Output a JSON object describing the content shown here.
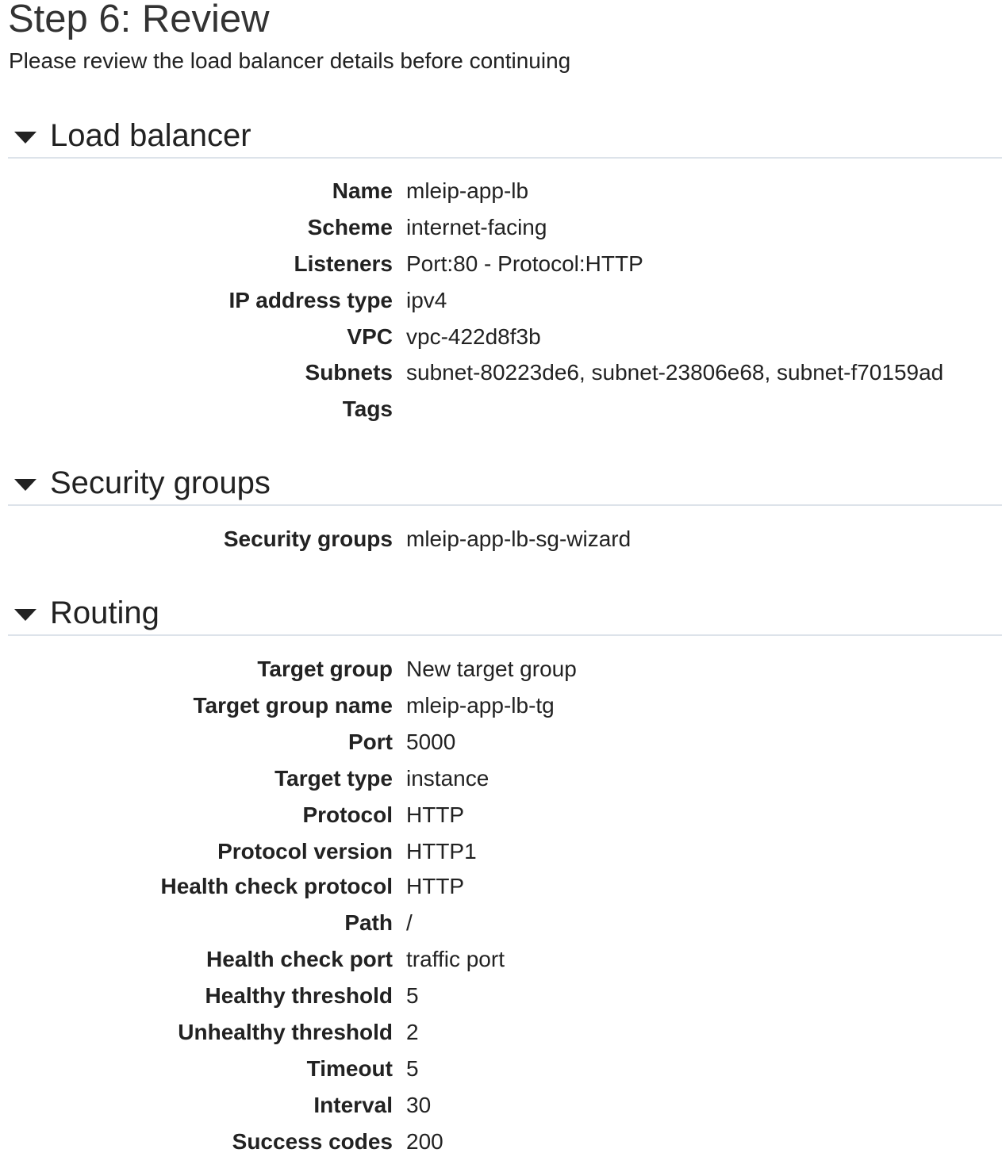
{
  "page": {
    "title": "Step 6: Review",
    "subtitle": "Please review the load balancer details before continuing"
  },
  "sections": {
    "load_balancer": {
      "title": "Load balancer",
      "rows": [
        {
          "label": "Name",
          "value": "mleip-app-lb"
        },
        {
          "label": "Scheme",
          "value": "internet-facing"
        },
        {
          "label": "Listeners",
          "value": "Port:80 - Protocol:HTTP"
        },
        {
          "label": "IP address type",
          "value": "ipv4"
        },
        {
          "label": "VPC",
          "value": "vpc-422d8f3b"
        },
        {
          "label": "Subnets",
          "value": "subnet-80223de6, subnet-23806e68, subnet-f70159ad"
        },
        {
          "label": "Tags",
          "value": ""
        }
      ]
    },
    "security_groups": {
      "title": "Security groups",
      "rows": [
        {
          "label": "Security groups",
          "value": "mleip-app-lb-sg-wizard"
        }
      ]
    },
    "routing": {
      "title": "Routing",
      "rows": [
        {
          "label": "Target group",
          "value": "New target group"
        },
        {
          "label": "Target group name",
          "value": "mleip-app-lb-tg"
        },
        {
          "label": "Port",
          "value": "5000"
        },
        {
          "label": "Target type",
          "value": "instance"
        },
        {
          "label": "Protocol",
          "value": "HTTP"
        },
        {
          "label": "Protocol version",
          "value": "HTTP1"
        },
        {
          "label": "Health check protocol",
          "value": "HTTP"
        },
        {
          "label": "Path",
          "value": "/"
        },
        {
          "label": "Health check port",
          "value": "traffic port"
        },
        {
          "label": "Healthy threshold",
          "value": "5"
        },
        {
          "label": "Unhealthy threshold",
          "value": "2"
        },
        {
          "label": "Timeout",
          "value": "5"
        },
        {
          "label": "Interval",
          "value": "30"
        },
        {
          "label": "Success codes",
          "value": "200"
        }
      ]
    }
  }
}
